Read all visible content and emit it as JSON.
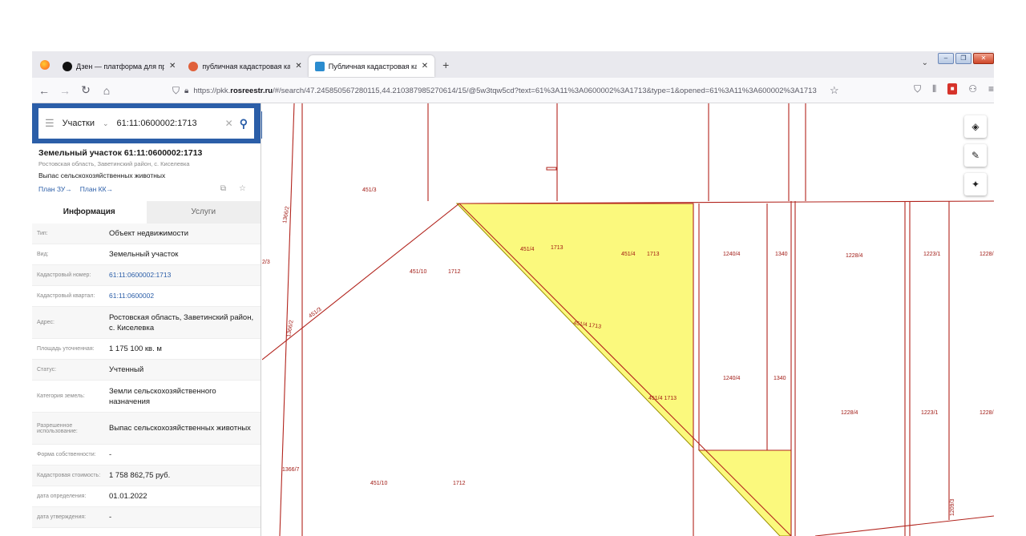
{
  "browser": {
    "tabs": [
      {
        "title": "Дзен — платформа для просм",
        "icon_color": "#111111"
      },
      {
        "title": "публичная кадастровая карта",
        "icon_color": "#e0603a"
      },
      {
        "title": "Публичная кадастровая карта",
        "icon_color": "#2b8ccf"
      }
    ],
    "new_tab": "+",
    "url_prefix": "https://pkk.",
    "url_host": "rosreestr.ru",
    "url_rest": "/#/search/47.245850567280115,44.210387985270614/15/@5w3tqw5cd?text=61%3A11%3A0600002%3A1713&type=1&opened=61%3A11%3A600002%3A1713"
  },
  "search": {
    "type_label": "Участки",
    "value": "61:11:0600002:1713"
  },
  "object": {
    "title": "Земельный участок 61:11:0600002:1713",
    "address_short": "Ростовская область, Заветинский район, с. Киселевка",
    "use": "Выпас сельскохозяйственных животных",
    "plan_zu": "План ЗУ→",
    "plan_kk": "План КК→"
  },
  "info_tabs": {
    "info": "Информация",
    "services": "Услуги"
  },
  "properties": [
    {
      "key": "Тип:",
      "value": "Объект недвижимости",
      "link": false
    },
    {
      "key": "Вид:",
      "value": "Земельный участок",
      "link": false
    },
    {
      "key": "Кадастровый номер:",
      "value": "61:11:0600002:1713",
      "link": true
    },
    {
      "key": "Кадастровый квартал:",
      "value": "61:11:0600002",
      "link": true
    },
    {
      "key": "Адрес:",
      "value": "Ростовская область, Заветинский район, с. Киселевка",
      "link": false
    },
    {
      "key": "Площадь уточненная:",
      "value": "1 175 100 кв. м",
      "link": false
    },
    {
      "key": "Статус:",
      "value": "Учтенный",
      "link": false
    },
    {
      "key": "Категория земель:",
      "value": "Земли сельскохозяйственного назначения",
      "link": false
    },
    {
      "key": "Разрешенное использование:",
      "value": "Выпас сельскохозяйственных животных",
      "link": false
    },
    {
      "key": "Форма собственности:",
      "value": "-",
      "link": false
    },
    {
      "key": "Кадастровая стоимость:",
      "value": "1 758 862,75 руб.",
      "link": false
    },
    {
      "key": "дата определения:",
      "value": "01.01.2022",
      "link": false
    },
    {
      "key": "дата утверждения:",
      "value": "-",
      "link": false
    }
  ],
  "map_labels": [
    "451/3",
    "1366/2",
    "451/4",
    "1713",
    "451/4",
    "1713",
    "1240/4",
    "1340",
    "1228/4",
    "1223/1",
    "1228/",
    "451/10",
    "1712",
    "451/3",
    "1366/2",
    "451/4 1713",
    "1240/4",
    "1340",
    "451/4 1713",
    "1228/4",
    "1223/1",
    "1228/",
    "1366/7",
    "451/10",
    "1712",
    "1209/3",
    "2/3"
  ],
  "colors": {
    "header_blue": "#2b5ea8",
    "parcel_fill": "#fbf97d",
    "boundary": "#b2241d"
  }
}
